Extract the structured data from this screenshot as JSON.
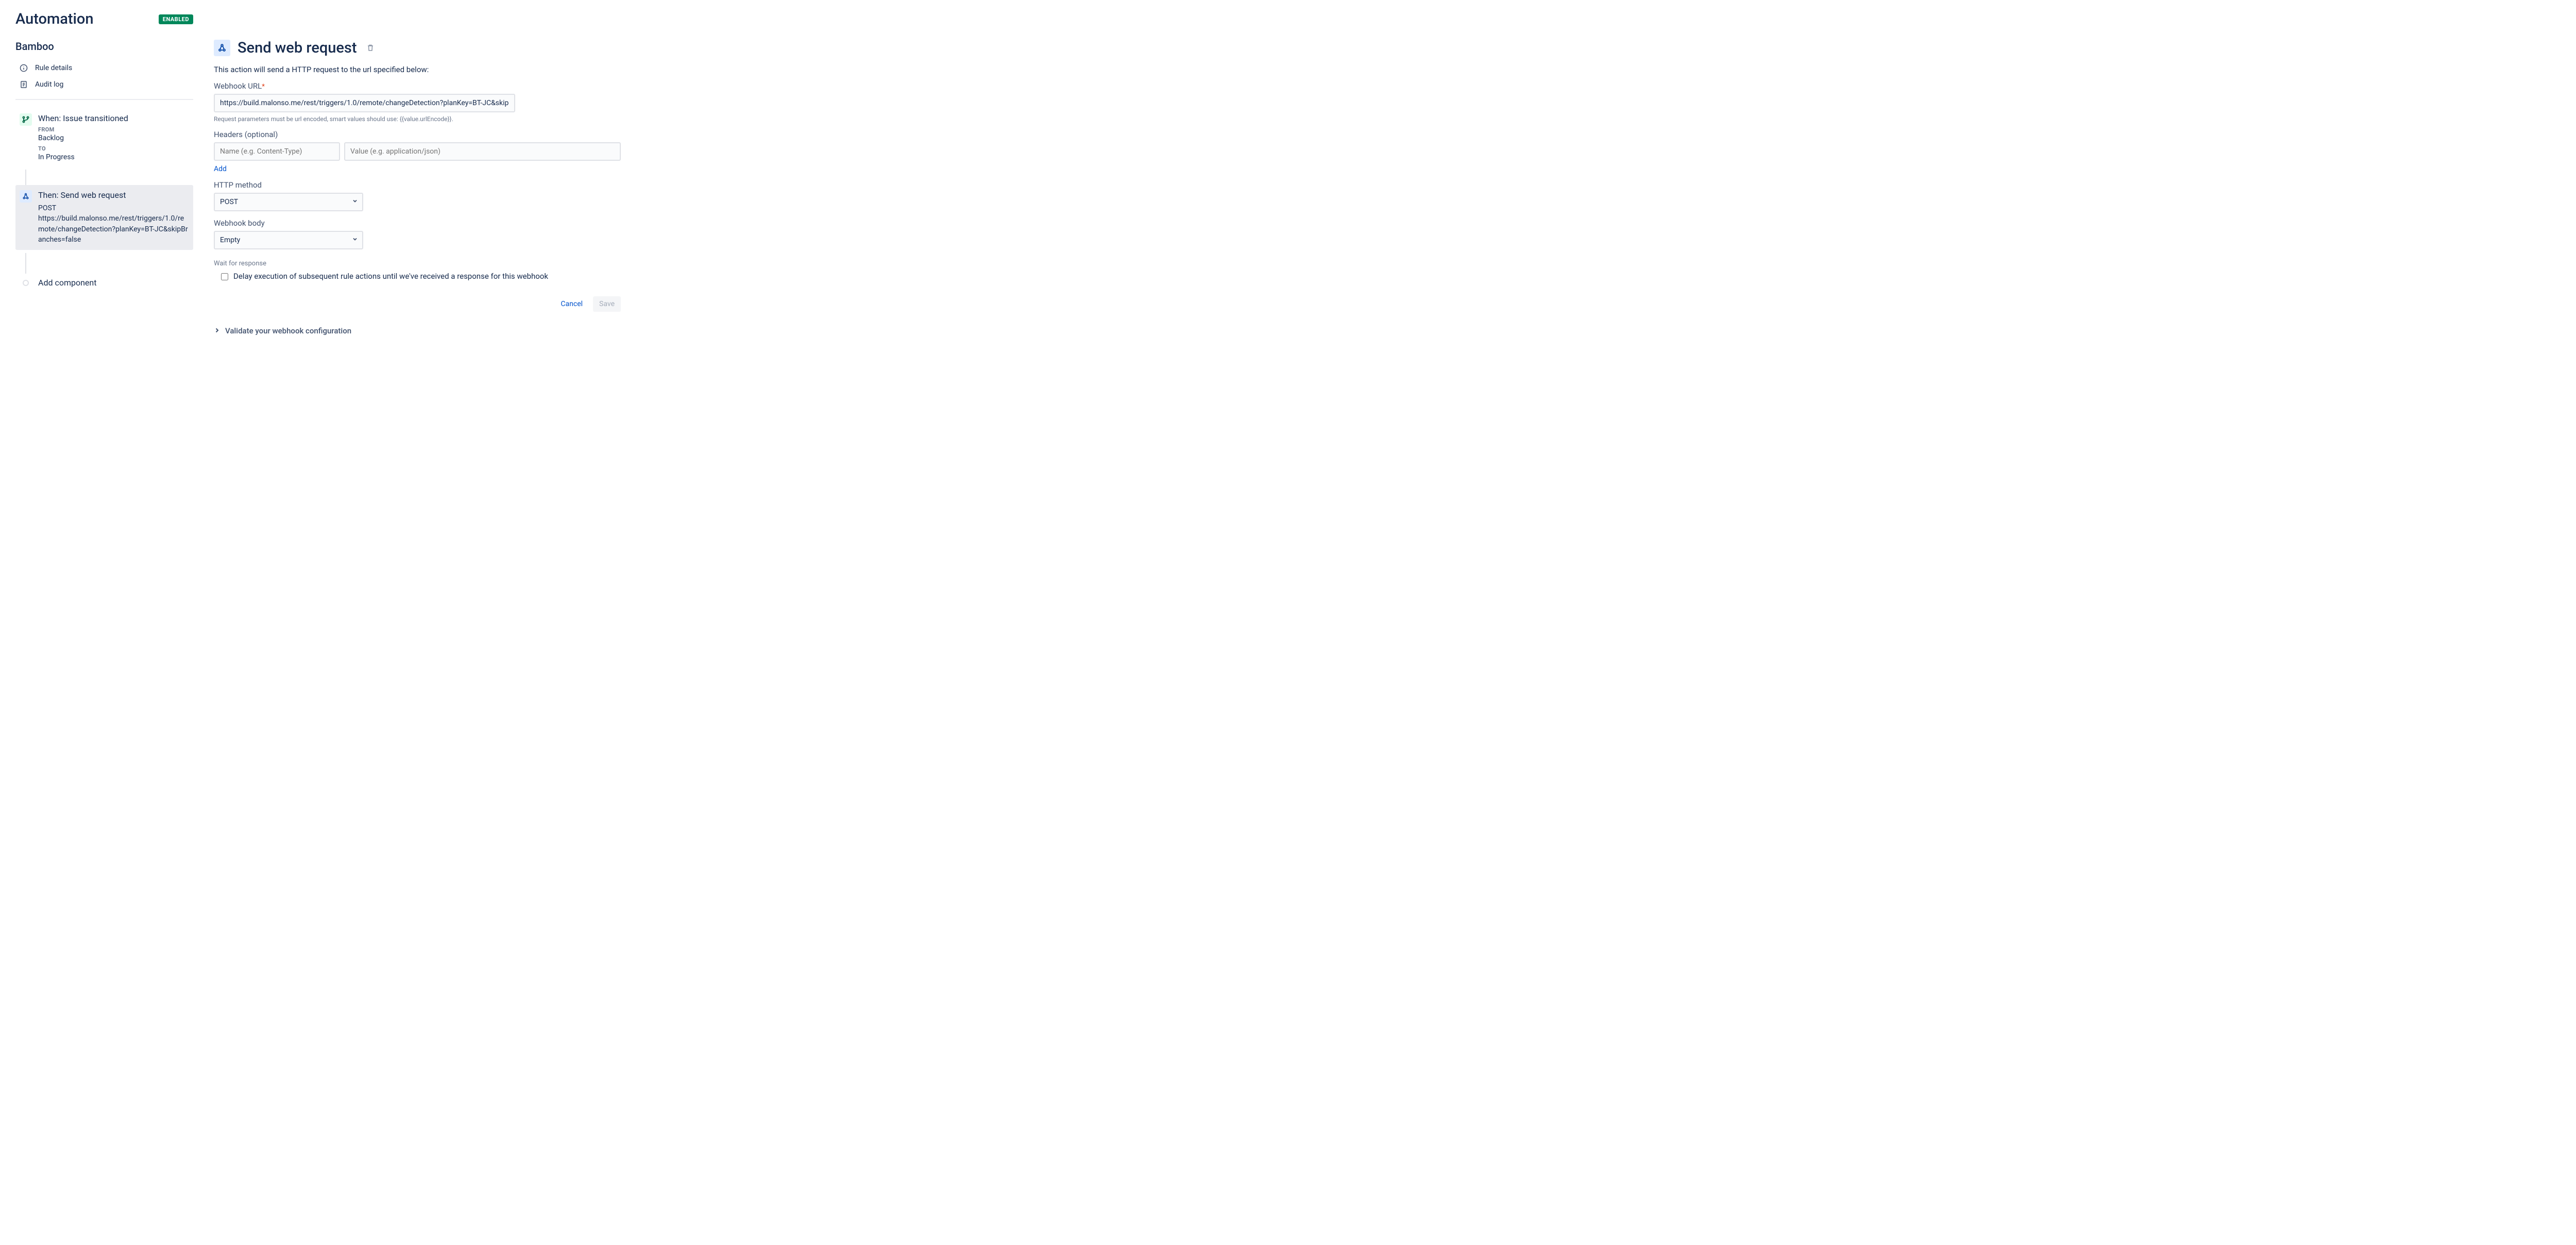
{
  "header": {
    "title": "Automation",
    "badge": "ENABLED"
  },
  "rule": {
    "name": "Bamboo",
    "nav": {
      "details": "Rule details",
      "audit": "Audit log"
    }
  },
  "flow": {
    "trigger": {
      "title": "When: Issue transitioned",
      "from_label": "FROM",
      "from_value": "Backlog",
      "to_label": "TO",
      "to_value": "In Progress"
    },
    "action": {
      "title": "Then: Send web request",
      "method": "POST",
      "url": "https://build.malonso.me/rest/triggers/1.0/remote/changeDetection?planKey=BT-JC&skipBranches=false"
    },
    "add_component": "Add component"
  },
  "detail": {
    "title": "Send web request",
    "description": "This action will send a HTTP request to the url specified below:",
    "webhook_url_label": "Webhook URL",
    "webhook_url_value": "https://build.malonso.me/rest/triggers/1.0/remote/changeDetection?planKey=BT-JC&skipBranches=false",
    "webhook_url_helper": "Request parameters must be url encoded, smart values should use: {{value.urlEncode}}.",
    "headers_label": "Headers (optional)",
    "header_name_placeholder": "Name (e.g. Content-Type)",
    "header_value_placeholder": "Value (e.g. application/json)",
    "add_link": "Add",
    "method_label": "HTTP method",
    "method_value": "POST",
    "body_label": "Webhook body",
    "body_value": "Empty",
    "wait_label": "Wait for response",
    "wait_checkbox_label": "Delay execution of subsequent rule actions until we've received a response for this webhook",
    "cancel": "Cancel",
    "save": "Save",
    "validate": "Validate your webhook configuration"
  }
}
